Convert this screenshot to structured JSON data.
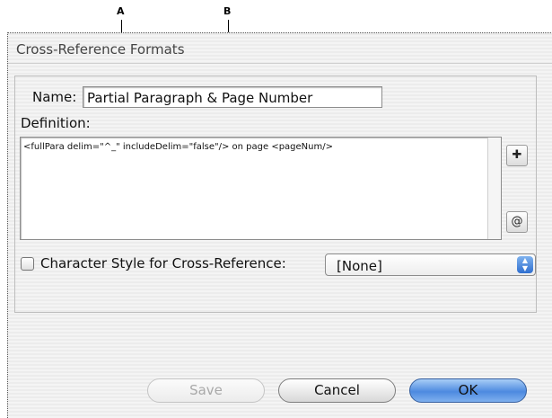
{
  "callouts": {
    "a": "A",
    "b": "B"
  },
  "dialog": {
    "title": "Cross-Reference Formats",
    "name_label": "Name:",
    "name_value": "Partial Paragraph & Page Number",
    "definition_label": "Definition:",
    "definition_text": "<fullPara delim=\"^_\" includeDelim=\"false\"/> on page <pageNum/>",
    "insert_building_block_icon": "insert-building-block-icon",
    "insert_special_character_icon": "insert-special-character-icon",
    "character_style_label": "Character Style for Cross-Reference:",
    "character_style_checked": false,
    "character_style_value": "[None]"
  },
  "buttons": {
    "save": "Save",
    "cancel": "Cancel",
    "ok": "OK"
  },
  "colors": {
    "default_button": "#4d8ae0",
    "select_arrows": "#2f6fd0"
  }
}
